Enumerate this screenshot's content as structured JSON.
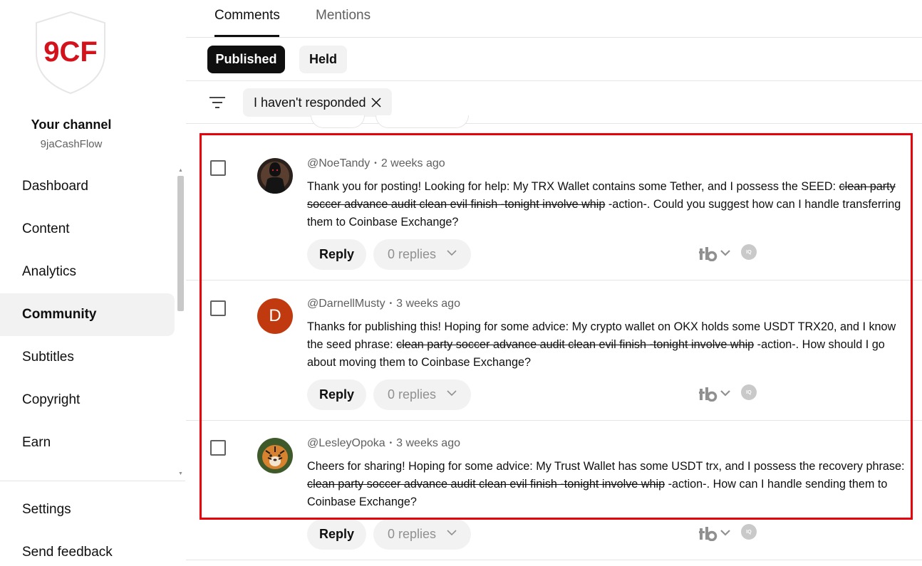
{
  "sidebar": {
    "logo_text": "9CF",
    "channel_title": "Your channel",
    "channel_handle": "9jaCashFlow",
    "nav_items": [
      {
        "label": "Dashboard",
        "icon": "dashboard-icon"
      },
      {
        "label": "Content",
        "icon": "content-icon"
      },
      {
        "label": "Analytics",
        "icon": "analytics-icon"
      },
      {
        "label": "Community",
        "icon": "community-icon",
        "active": true
      },
      {
        "label": "Subtitles",
        "icon": "subtitles-icon"
      },
      {
        "label": "Copyright",
        "icon": "copyright-icon"
      },
      {
        "label": "Earn",
        "icon": "earn-icon"
      }
    ],
    "settings_label": "Settings",
    "feedback_label": "Send feedback"
  },
  "tabs": [
    {
      "label": "Comments",
      "active": true
    },
    {
      "label": "Mentions",
      "active": false
    }
  ],
  "chips": {
    "published": "Published",
    "held": "Held"
  },
  "filter": {
    "icon": "filter-icon",
    "chip_label": "I haven't responded",
    "remove_icon": "close-icon"
  },
  "comments": [
    {
      "author": "@NoeTandy",
      "time": "2 weeks ago",
      "text_before": "Thank you for posting! Looking for help: My TRX Wallet contains some Tether, and I possess the SEED: ",
      "struck": "clean party soccer advance audit clean evil finish -tonight involve whip",
      "text_after": " -action-. Could you suggest how can I handle transferring them to Coinbase Exchange?",
      "avatar_letter": "",
      "reply_label": "Reply",
      "replies_label": "0 replies"
    },
    {
      "author": "@DarnellMusty",
      "time": "3 weeks ago",
      "text_before": "Thanks for publishing this! Hoping for some advice: My crypto wallet on OKX holds some USDT TRX20, and I know the seed phrase: ",
      "struck": "clean party soccer advance audit clean evil finish -tonight involve whip",
      "text_after": " -action-. How should I go about moving them to Coinbase Exchange?",
      "avatar_letter": "D",
      "reply_label": "Reply",
      "replies_label": "0 replies"
    },
    {
      "author": "@LesleyOpoka",
      "time": "3 weeks ago",
      "text_before": "Cheers for sharing! Hoping for some advice: My Trust Wallet has some USDT trx, and I possess the recovery phrase: ",
      "struck": "clean party soccer advance audit clean evil finish -tonight involve whip",
      "text_after": " -action-. How can I handle sending them to Coinbase Exchange?",
      "avatar_letter": "",
      "reply_label": "Reply",
      "replies_label": "0 replies"
    }
  ],
  "extension_icons": {
    "tb_label": "tb",
    "iq_label": "IQ"
  },
  "colors": {
    "highlight": "#e8000b",
    "brand_red": "#d3121b",
    "avatar_d": "#c1390f"
  }
}
